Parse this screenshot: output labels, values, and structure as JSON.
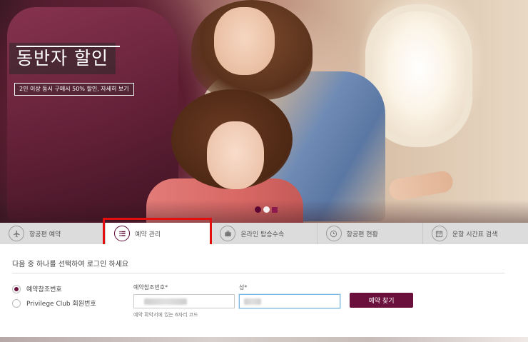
{
  "hero": {
    "promo_title": "동반자 할인",
    "promo_subtitle": "2인 이상 동시 구매시 50% 할인, 자세히 보기",
    "carousel_dots": 3
  },
  "tabs": [
    {
      "label": "항공편 예약",
      "icon": "airplane-icon",
      "active": false
    },
    {
      "label": "예약 관리",
      "icon": "list-icon",
      "active": true
    },
    {
      "label": "온라인 탑승수속",
      "icon": "briefcase-icon",
      "active": false
    },
    {
      "label": "항공편 현황",
      "icon": "clock-icon",
      "active": false
    },
    {
      "label": "운항 시간표 검색",
      "icon": "calendar-icon",
      "active": false
    }
  ],
  "panel": {
    "instruction": "다음 중 하나를 선택하여 로그인 하세요",
    "options": [
      {
        "label": "예약참조번호",
        "selected": true
      },
      {
        "label": "Privilege Club 회원번호",
        "selected": false
      }
    ],
    "booking_ref_label": "예약참조번호*",
    "booking_ref_hint": "예약 확약서에 있는 6자리 코드",
    "lastname_label": "성*",
    "search_button": "예약 찾기"
  },
  "colors": {
    "brand": "#6b0f3c",
    "highlight": "#e30e0e"
  }
}
